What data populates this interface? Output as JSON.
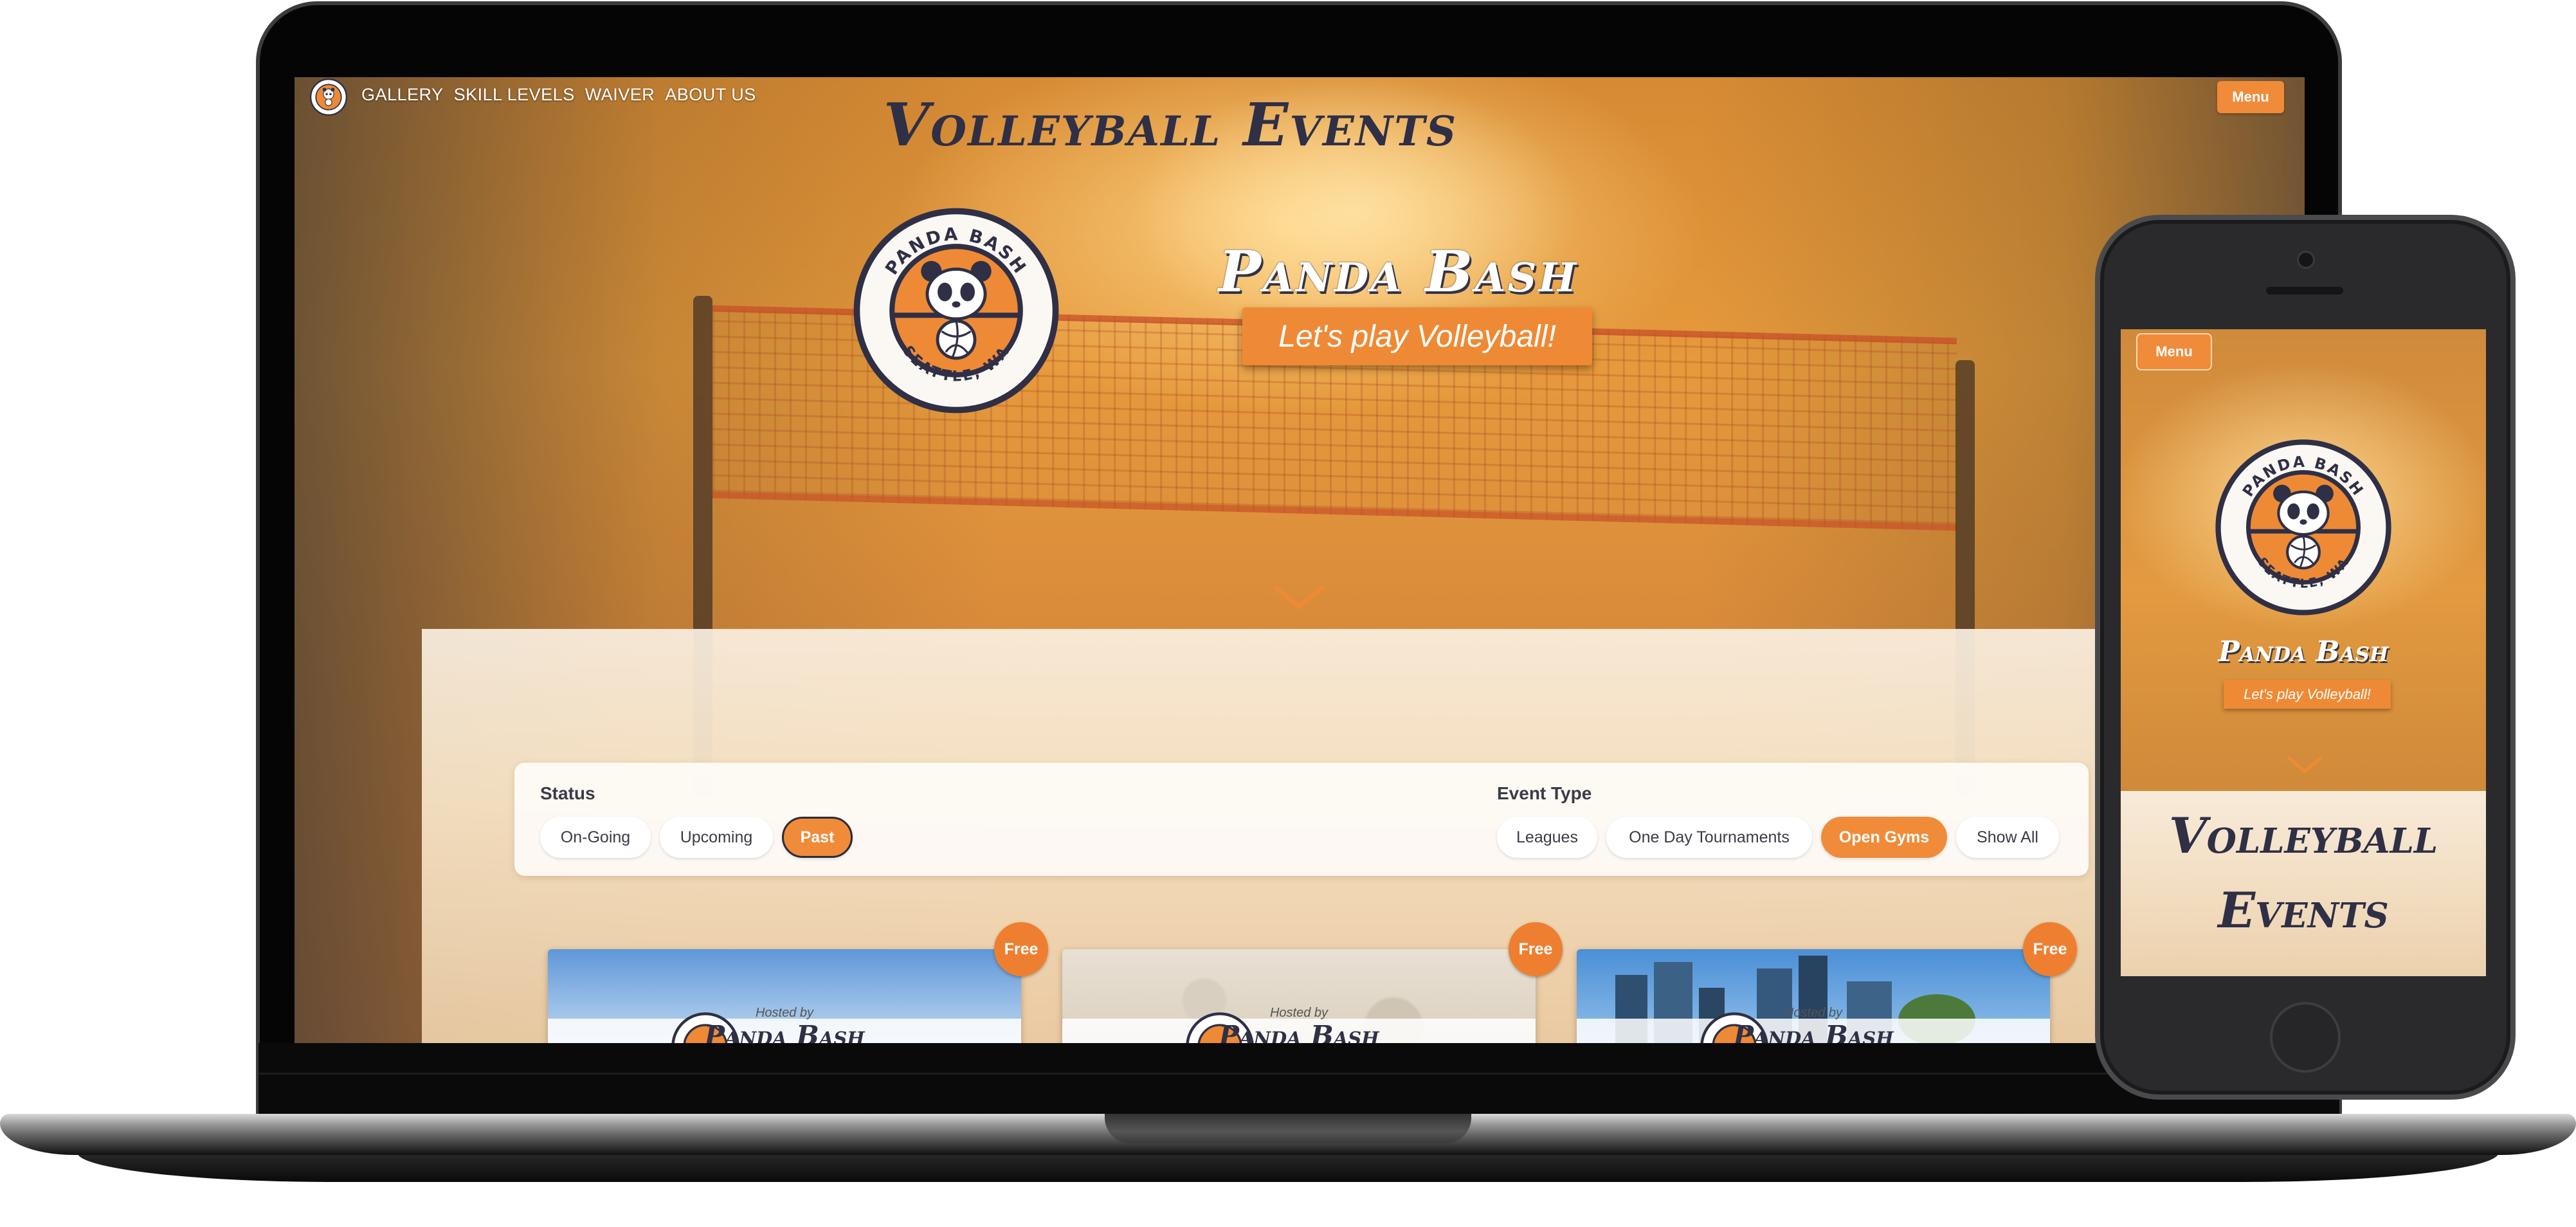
{
  "colors": {
    "accent": "#F08B3A",
    "navy": "#2F2F46",
    "panel": "#F7E7D2",
    "white": "#FFFFFF"
  },
  "logo": {
    "top_text": "PANDA BASH",
    "bottom_text": "SEATTLE, WA"
  },
  "desktop": {
    "nav": {
      "links": [
        "GALLERY",
        "SKILL LEVELS",
        "WAIVER",
        "ABOUT US"
      ],
      "menu_label": "Menu"
    },
    "hero": {
      "title": "Panda Bash",
      "subtitle": "Let's play Volleyball!"
    },
    "events": {
      "title": "Volleyball Events",
      "status": {
        "label": "Status",
        "options": [
          "On-Going",
          "Upcoming",
          "Past"
        ],
        "selected": "Past"
      },
      "event_type": {
        "label": "Event Type",
        "options": [
          "Leagues",
          "One Day Tournaments",
          "Open Gyms",
          "Show All"
        ],
        "selected": "Open Gyms"
      },
      "cards": [
        {
          "badge": "Free",
          "hosted": "Hosted by",
          "brand": "Panda Bash"
        },
        {
          "badge": "Free",
          "hosted": "Hosted by",
          "brand": "Panda Bash"
        },
        {
          "badge": "Free",
          "hosted": "Hosted by",
          "brand": "Panda Bash"
        }
      ]
    }
  },
  "mobile": {
    "menu_label": "Menu",
    "hero": {
      "title": "Panda Bash",
      "subtitle": "Let's play Volleyball!"
    },
    "events": {
      "title_line1": "Volleyball",
      "title_line2": "Events"
    }
  }
}
